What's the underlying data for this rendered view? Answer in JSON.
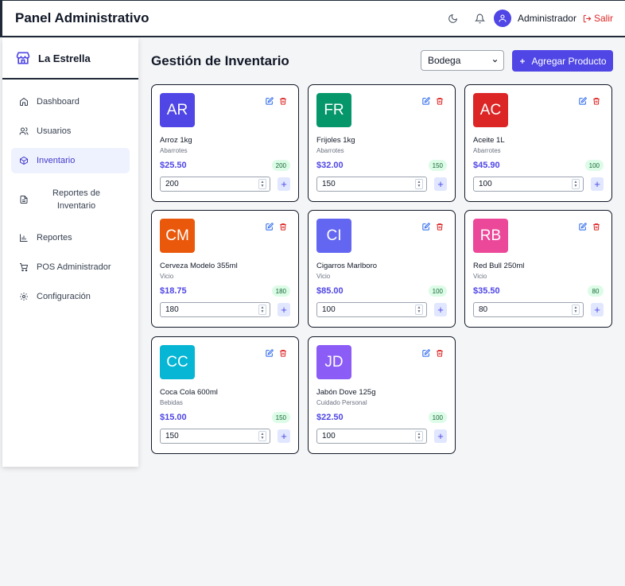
{
  "header": {
    "title": "Panel Administrativo",
    "user": "Administrador",
    "logout": "Salir"
  },
  "sidebar": {
    "brand": "La Estrella",
    "items": [
      {
        "label": "Dashboard",
        "icon": "home-icon"
      },
      {
        "label": "Usuarios",
        "icon": "users-icon"
      },
      {
        "label": "Inventario",
        "icon": "box-icon",
        "active": true
      },
      {
        "label": "Reportes de Inventario",
        "icon": "document-icon"
      },
      {
        "label": "Reportes",
        "icon": "bar-chart-icon"
      },
      {
        "label": "POS Administrador",
        "icon": "cart-icon"
      },
      {
        "label": "Configuración",
        "icon": "gear-icon"
      }
    ]
  },
  "main": {
    "title": "Gestión de Inventario",
    "filter_value": "Bodega",
    "add_label": "Agregar Producto"
  },
  "colors": {
    "accent": "#4f46e5",
    "danger": "#dc2626",
    "stock_bg": "#dcfce7"
  },
  "products": [
    {
      "initials": "AR",
      "name": "Arroz 1kg",
      "category": "Abarrotes",
      "price": "$25.50",
      "stock": "200",
      "qty": "200",
      "color": "#4f46e5"
    },
    {
      "initials": "FR",
      "name": "Frijoles 1kg",
      "category": "Abarrotes",
      "price": "$32.00",
      "stock": "150",
      "qty": "150",
      "color": "#059669"
    },
    {
      "initials": "AC",
      "name": "Aceite 1L",
      "category": "Abarrotes",
      "price": "$45.90",
      "stock": "100",
      "qty": "100",
      "color": "#dc2626"
    },
    {
      "initials": "CM",
      "name": "Cerveza Modelo 355ml",
      "category": "Vicio",
      "price": "$18.75",
      "stock": "180",
      "qty": "180",
      "color": "#ea580c"
    },
    {
      "initials": "CI",
      "name": "Cigarros Marlboro",
      "category": "Vicio",
      "price": "$85.00",
      "stock": "100",
      "qty": "100",
      "color": "#6366f1"
    },
    {
      "initials": "RB",
      "name": "Red Bull 250ml",
      "category": "Vicio",
      "price": "$35.50",
      "stock": "80",
      "qty": "80",
      "color": "#ec4899"
    },
    {
      "initials": "CC",
      "name": "Coca Cola 600ml",
      "category": "Bebidas",
      "price": "$15.00",
      "stock": "150",
      "qty": "150",
      "color": "#06b6d4"
    },
    {
      "initials": "JD",
      "name": "Jabón Dove 125g",
      "category": "Cuidado Personal",
      "price": "$22.50",
      "stock": "100",
      "qty": "100",
      "color": "#8b5cf6"
    }
  ]
}
